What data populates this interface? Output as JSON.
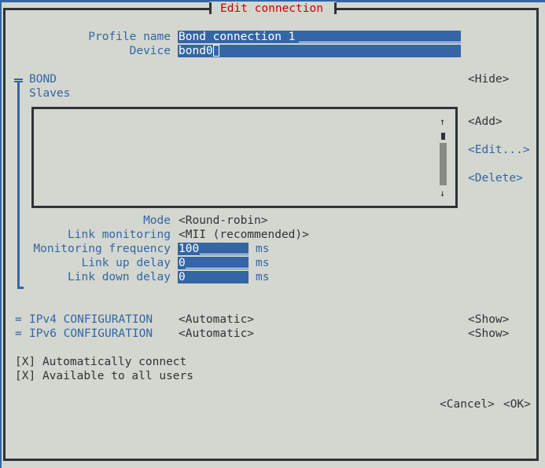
{
  "dialog": {
    "title": "Edit connection"
  },
  "general": {
    "profile_name_label": "Profile name",
    "profile_name_value": "Bond connection 1",
    "device_label": "Device",
    "device_value": "bond0"
  },
  "bond": {
    "section_label": "BOND",
    "toggle_label": "<Hide>",
    "slaves_label": "Slaves",
    "slaves": [],
    "scroll_up": "↑",
    "scroll_down": "↓",
    "add_label": "<Add>",
    "edit_label": "<Edit...>",
    "delete_label": "<Delete>",
    "mode_label": "Mode",
    "mode_value": "<Round-robin>",
    "link_monitoring_label": "Link monitoring",
    "link_monitoring_value": "<MII (recommended)>",
    "monitoring_frequency_label": "Monitoring frequency",
    "monitoring_frequency_value": "100",
    "link_up_delay_label": "Link up delay",
    "link_up_delay_value": "0",
    "link_down_delay_label": "Link down delay",
    "link_down_delay_value": "0",
    "unit": "ms"
  },
  "ipv4": {
    "marker": "=",
    "label": "IPv4 CONFIGURATION",
    "value": "<Automatic>",
    "toggle_label": "<Show>"
  },
  "ipv6": {
    "marker": "=",
    "label": "IPv6 CONFIGURATION",
    "value": "<Automatic>",
    "toggle_label": "<Show>"
  },
  "options": {
    "auto_connect_box": "[X]",
    "auto_connect_label": "Automatically connect",
    "all_users_box": "[X]",
    "all_users_label": "Available to all users"
  },
  "buttons": {
    "cancel_label": "<Cancel>",
    "ok_label": "<OK>"
  },
  "colors": {
    "background": "#d3d7cf",
    "accent": "#3465a4",
    "title": "#cc0000",
    "frame": "#2e3436"
  }
}
